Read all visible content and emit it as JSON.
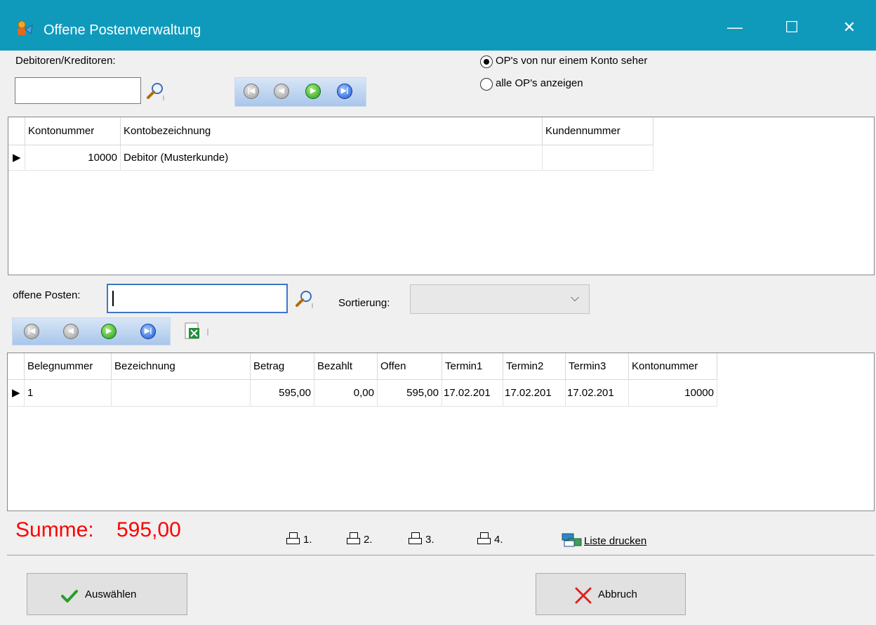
{
  "window": {
    "title": "Offene Postenverwaltung",
    "minimize": "—",
    "maximize": "☐",
    "close": "✕"
  },
  "top": {
    "label_debitoren": "Debitoren/Kreditoren:",
    "radio_one": "OP's von nur einem Konto seher",
    "radio_all": "alle OP's anzeigen"
  },
  "accounts": {
    "headers": [
      "Kontonummer",
      "Kontobezeichnung",
      "Kundennummer"
    ],
    "rows": [
      {
        "kontonummer": "10000",
        "kontobezeichnung": "Debitor (Musterkunde)",
        "kundennummer": ""
      }
    ]
  },
  "filter": {
    "label_offene": "offene Posten:",
    "label_sortierung": "Sortierung:",
    "sortierung_value": ""
  },
  "items": {
    "headers": [
      "Belegnummer",
      "Bezeichnung",
      "Betrag",
      "Bezahlt",
      "Offen",
      "Termin1",
      "Termin2",
      "Termin3",
      "Kontonummer"
    ],
    "rows": [
      {
        "belegnummer": "1",
        "bezeichnung": "",
        "betrag": "595,00",
        "bezahlt": "0,00",
        "offen": "595,00",
        "termin1": "17.02.201",
        "termin2": "17.02.201",
        "termin3": "17.02.201",
        "kontonummer": "10000"
      }
    ]
  },
  "footer": {
    "summe_label": "Summe:",
    "summe_value": "595,00",
    "print1": "1.",
    "print2": "2.",
    "print3": "3.",
    "print4": "4.",
    "liste_drucken": "Liste drucken",
    "auswaehlen": "Auswählen",
    "abbruch": "Abbruch"
  },
  "colors": {
    "titlebar": "#0f9abc",
    "summe": "#ff0000",
    "accept_check": "#2a9d2a",
    "cancel_x": "#e02020"
  }
}
